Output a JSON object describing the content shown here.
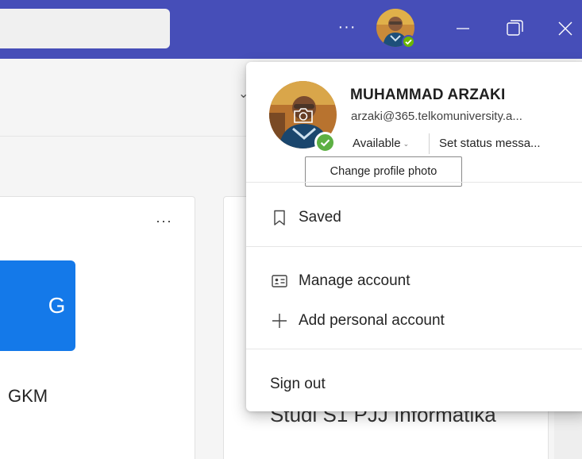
{
  "titlebar": {
    "more_label": "···",
    "icons": {
      "minimize": "minimize-icon",
      "maximize": "restore-icon",
      "close": "close-icon"
    },
    "colors": {
      "bar": "#464eb8",
      "status_available": "#6bb700"
    }
  },
  "background": {
    "team_card": {
      "tile_letter": "G",
      "tile_color": "#1479e9",
      "name": "GKM",
      "more_label": "···"
    },
    "right_card_text": "Studi S1 PJJ Informatika"
  },
  "account": {
    "name": "MUHAMMAD ARZAKI",
    "email": "arzaki@365.telkomuniversity.a...",
    "status": "Available",
    "set_status": "Set status messa...",
    "photo_tooltip": "Change profile photo",
    "menu": {
      "saved": "Saved",
      "manage": "Manage account",
      "add_personal": "Add personal account",
      "sign_out": "Sign out"
    }
  }
}
